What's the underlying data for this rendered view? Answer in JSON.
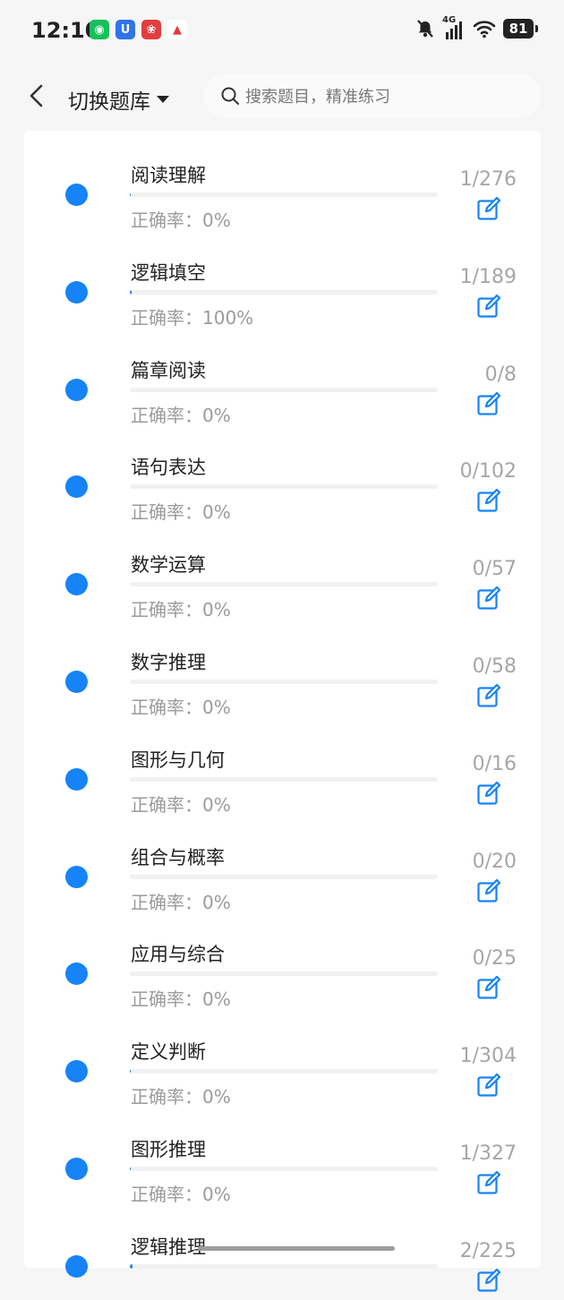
{
  "status_bar": {
    "time": "12:10",
    "network": "4G",
    "battery": "81"
  },
  "header": {
    "back_icon": "chevron-left-icon",
    "title": "切换题库",
    "search_placeholder": "搜索题目，精准练习"
  },
  "colors": {
    "accent": "#1683f6",
    "muted": "#a6a6a6",
    "track": "#f1f1f1"
  },
  "categories": [
    {
      "name": "阅读理解",
      "accuracy": "正确率：0%",
      "count": "1/276",
      "progress": 0.0036
    },
    {
      "name": "逻辑填空",
      "accuracy": "正确率：100%",
      "count": "1/189",
      "progress": 0.0053
    },
    {
      "name": "篇章阅读",
      "accuracy": "正确率：0%",
      "count": "0/8",
      "progress": 0
    },
    {
      "name": "语句表达",
      "accuracy": "正确率：0%",
      "count": "0/102",
      "progress": 0
    },
    {
      "name": "数学运算",
      "accuracy": "正确率：0%",
      "count": "0/57",
      "progress": 0
    },
    {
      "name": "数字推理",
      "accuracy": "正确率：0%",
      "count": "0/58",
      "progress": 0
    },
    {
      "name": "图形与几何",
      "accuracy": "正确率：0%",
      "count": "0/16",
      "progress": 0
    },
    {
      "name": "组合与概率",
      "accuracy": "正确率：0%",
      "count": "0/20",
      "progress": 0
    },
    {
      "name": "应用与综合",
      "accuracy": "正确率：0%",
      "count": "0/25",
      "progress": 0
    },
    {
      "name": "定义判断",
      "accuracy": "正确率：0%",
      "count": "1/304",
      "progress": 0.0033
    },
    {
      "name": "图形推理",
      "accuracy": "正确率：0%",
      "count": "1/327",
      "progress": 0.0031
    },
    {
      "name": "逻辑推理",
      "accuracy": "",
      "count": "2/225",
      "progress": 0.0089
    }
  ]
}
